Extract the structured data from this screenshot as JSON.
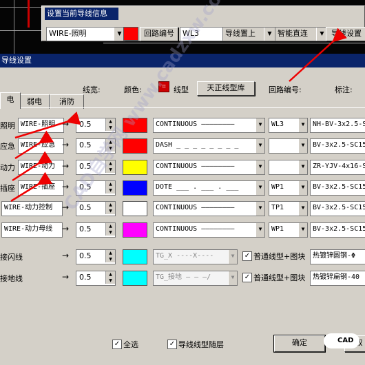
{
  "toolbar": {
    "title": "设置当前导线信息",
    "wire_type": "WIRE-照明",
    "color": "#ff0000",
    "circuit_btn": "回路编号",
    "circuit_value": "WL3",
    "position": "导线置上",
    "mode": "智能直连",
    "settings_btn": "导线设置"
  },
  "dialog": {
    "title": "导线设置",
    "headers": {
      "width": "线宽:",
      "color": "颜色:",
      "linetype": "线型",
      "lib_btn": "天正线型库",
      "circuit": "回路编号:",
      "annotation": "标注:"
    },
    "tabs": [
      "电",
      "弱电",
      "消防"
    ],
    "rows": [
      {
        "label": "照明",
        "layer": "WIRE-照明",
        "width": "0.5",
        "color": "#ff0000",
        "linetype": "CONTINUOUS ————————",
        "circuit": "WL3",
        "annotation": "NH-BV-3x2.5-S"
      },
      {
        "label": "应急",
        "layer": "WIRE-应急",
        "width": "0.5",
        "color": "#ff0000",
        "linetype": "DASH _ _ _ _ _ _ _ _",
        "circuit": "",
        "annotation": "BV-3x2.5-SC15"
      },
      {
        "label": "动力",
        "layer": "WIRE-动力",
        "width": "0.5",
        "color": "#ffff00",
        "linetype": "CONTINUOUS ————————",
        "circuit": "",
        "annotation": "ZR-YJV-4x16-S"
      },
      {
        "label": "插座",
        "layer": "WIRE-插座",
        "width": "0.5",
        "color": "#0000ff",
        "linetype": "DOTE ___ . ___ . ___",
        "circuit": "WP1",
        "annotation": "BV-3x2.5-SC15"
      },
      {
        "label": "",
        "layer": "WIRE-动力控制",
        "width": "0.5",
        "color": "#ffffff",
        "linetype": "CONTINUOUS ————————",
        "circuit": "TP1",
        "annotation": "BV-3x2.5-SC15"
      },
      {
        "label": "",
        "layer": "WIRE-动力母线",
        "width": "0.5",
        "color": "#ff00ff",
        "linetype": "CONTINUOUS ————————",
        "circuit": "WP1",
        "annotation": "BV-3x2.5-SC15"
      }
    ],
    "ground_rows": [
      {
        "label": "接闪线",
        "width": "0.5",
        "color": "#00ffff",
        "linetype": "TG_X ----X----",
        "option": "普通线型+图块",
        "annotation": "热镀锌圆钢-Φ"
      },
      {
        "label": "接地线",
        "width": "0.5",
        "color": "#00ffff",
        "linetype": "TG_接地 — — —/",
        "option": "普通线型+图块",
        "annotation": "热镀锌扁钢-40"
      }
    ],
    "select_all": "全选",
    "follow_layer": "导线线型随层",
    "ok": "确定",
    "cancel": "取"
  },
  "watermark": {
    "text": "CAD自学网 www.cadzxw.com",
    "logo": "CAD"
  }
}
